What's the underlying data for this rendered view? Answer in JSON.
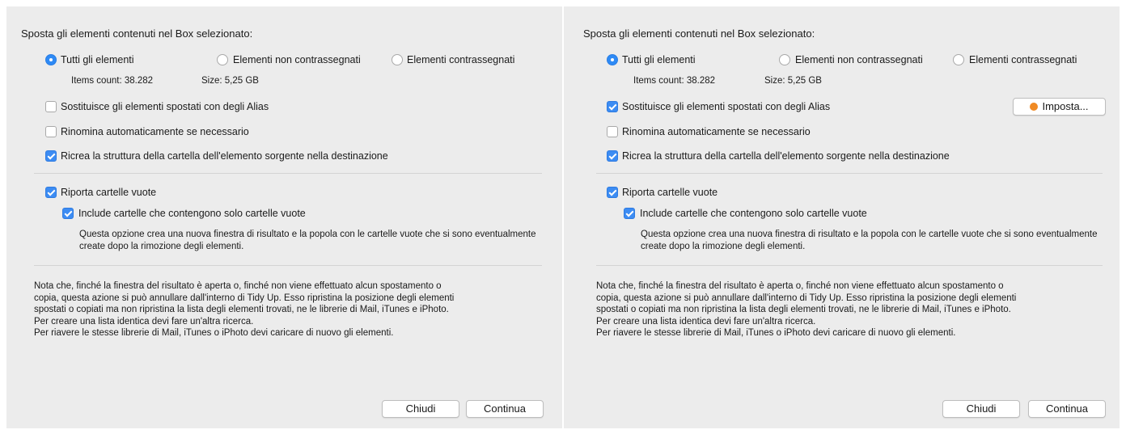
{
  "panels": [
    {
      "title": "Sposta gli elementi contenuti nel Box selezionato:",
      "radio_all": "Tutti gli elementi",
      "radio_unmarked": "Elementi non contrassegnati",
      "radio_marked": "Elementi contrassegnati",
      "items_count": "Items count: 38.282",
      "size": "Size: 5,25 GB",
      "replace_alias": "Sostituisce gli elementi spostati con degli Alias",
      "rename_auto": "Rinomina automaticamente se necessario",
      "recreate_structure": "Ricrea la struttura della cartella dell'elemento sorgente nella destinazione",
      "report_empty": "Riporta cartelle vuote",
      "include_empty": "Include cartelle che contengono solo cartelle vuote",
      "option_desc": "Questa opzione crea una nuova finestra di risultato e la popola con le cartelle vuote che si sono eventualmente create dopo la rimozione degli elementi.",
      "note_lines": [
        "Nota che, finché la finestra del risultato è aperta o, finché non viene effettuato alcun spostamento o",
        "copia, questa azione si può annullare dall'interno di Tidy Up. Esso ripristina la posizione degli elementi",
        "spostati o copiati ma non ripristina la lista degli elementi trovati, ne le librerie di Mail, iTunes e iPhoto.",
        "Per creare una lista identica devi fare un'altra ricerca.",
        "Per riavere le stesse librerie di Mail, iTunes o iPhoto devi caricare di nuovo gli elementi."
      ],
      "close_label": "Chiudi",
      "continue_label": "Continua"
    },
    {
      "title": "Sposta gli elementi contenuti nel Box selezionato:",
      "radio_all": "Tutti gli elementi",
      "radio_unmarked": "Elementi non contrassegnati",
      "radio_marked": "Elementi contrassegnati",
      "items_count": "Items count: 38.282",
      "size": "Size: 5,25 GB",
      "replace_alias": "Sostituisce gli elementi spostati con degli Alias",
      "setup_label": "Imposta...",
      "rename_auto": "Rinomina automaticamente se necessario",
      "recreate_structure": "Ricrea la struttura della cartella dell'elemento sorgente nella destinazione",
      "report_empty": "Riporta cartelle vuote",
      "include_empty": "Include cartelle che contengono solo cartelle vuote",
      "option_desc": "Questa opzione crea una nuova finestra di risultato e la popola con le cartelle vuote che si sono eventualmente create dopo la rimozione degli elementi.",
      "note_lines": [
        "Nota che, finché la finestra del risultato è aperta o, finché non viene effettuato alcun spostamento o",
        "copia, questa azione si può annullare dall'interno di Tidy Up. Esso ripristina la posizione degli elementi",
        "spostati o copiati ma non ripristina la lista degli elementi trovati, ne le librerie di Mail, iTunes e iPhoto.",
        "Per creare una lista identica devi fare un'altra ricerca.",
        "Per riavere le stesse librerie di Mail, iTunes o iPhoto devi caricare di nuovo gli elementi."
      ],
      "close_label": "Chiudi",
      "continue_label": "Continua"
    }
  ],
  "colors": {
    "accent_blue": "#3c8cf3",
    "setup_dot_orange": "#f08a24",
    "panel_background": "#ececec"
  },
  "states": {
    "left": {
      "radio": "all",
      "replace_alias": false,
      "rename_auto": false,
      "recreate_structure": true,
      "report_empty": true,
      "include_empty": true
    },
    "right": {
      "radio": "all",
      "replace_alias": true,
      "rename_auto": false,
      "recreate_structure": true,
      "report_empty": true,
      "include_empty": true
    }
  }
}
